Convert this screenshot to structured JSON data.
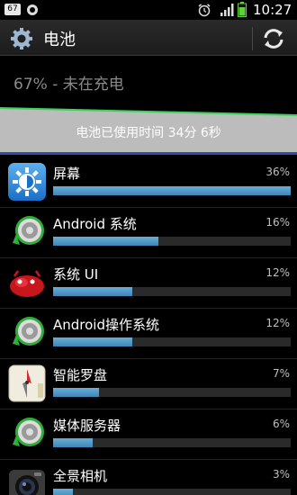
{
  "status_bar": {
    "badge": "67",
    "time": "10:27"
  },
  "action_bar": {
    "title": "电池"
  },
  "battery": {
    "status_text": "67% - 未在充电",
    "usage_text": "电池已使用时间 34分 6秒"
  },
  "colors": {
    "accent_bar": "#3d86b8",
    "graph_fill": "#bcbcbc",
    "graph_line": "#3bd25a",
    "background": "#000000"
  },
  "items": [
    {
      "name": "屏幕",
      "percent": "36%",
      "fraction": 0.36,
      "icon": "display-settings-icon"
    },
    {
      "name": "Android 系统",
      "percent": "16%",
      "fraction": 0.16,
      "icon": "android-system-icon"
    },
    {
      "name": "系统 UI",
      "percent": "12%",
      "fraction": 0.12,
      "icon": "system-ui-icon"
    },
    {
      "name": "Android操作系统",
      "percent": "12%",
      "fraction": 0.12,
      "icon": "android-os-icon"
    },
    {
      "name": "智能罗盘",
      "percent": "7%",
      "fraction": 0.07,
      "icon": "compass-icon"
    },
    {
      "name": "媒体服务器",
      "percent": "6%",
      "fraction": 0.06,
      "icon": "media-server-icon"
    },
    {
      "name": "全景相机",
      "percent": "3%",
      "fraction": 0.03,
      "icon": "panorama-camera-icon"
    }
  ]
}
